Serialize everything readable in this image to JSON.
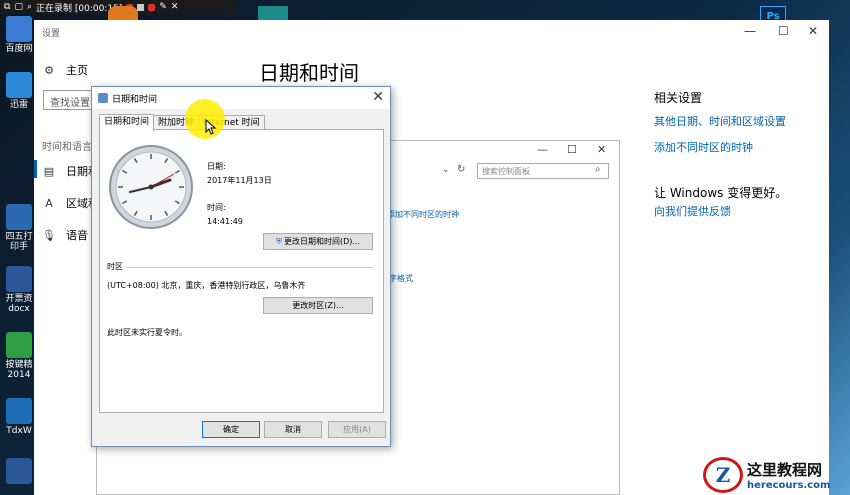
{
  "recorder": {
    "status": "正在录制 [00:00:15]"
  },
  "desktop": {
    "icons": [
      {
        "label": "百度网",
        "color": "#3a7bd5"
      },
      {
        "label": "迅雷",
        "color": "#2d8ad8"
      },
      {
        "label": "四五打印手",
        "color": "#2a6ab0"
      },
      {
        "label": "开票资docx",
        "color": "#2b579a"
      },
      {
        "label": "按键精2014",
        "color": "#2e9e44"
      },
      {
        "label": "TdxW",
        "color": "#1f6fb8"
      },
      {
        "label": "W",
        "color": "#2b579a"
      }
    ]
  },
  "settings": {
    "window_title": "设置",
    "nav": {
      "home": "主页",
      "search_placeholder": "查找设置",
      "section": "时间和语言",
      "items": [
        "日期和",
        "区域和",
        "语音"
      ]
    },
    "page_title": "日期和时间",
    "related": {
      "heading": "相关设置",
      "links": [
        "其他日期、时间和区域设置",
        "添加不同时区的时钟"
      ],
      "improve_heading": "让 Windows 变得更好。",
      "feedback_link": "向我们提供反馈"
    }
  },
  "control_panel": {
    "search_placeholder": "搜索控制面板",
    "partial_link_1": "添加不同时区的时钟",
    "partial_link_2": "字格式"
  },
  "dialog": {
    "title": "日期和时间",
    "tabs": [
      "日期和时间",
      "附加时钟",
      "Internet 时间"
    ],
    "date_label": "日期:",
    "date_value": "2017年11月13日",
    "time_label": "时间:",
    "time_value": "14:41:49",
    "change_datetime_button": "更改日期和时间(D)...",
    "timezone_heading": "时区",
    "timezone_value": "(UTC+08:00) 北京，重庆，香港特别行政区，乌鲁木齐",
    "change_timezone_button": "更改时区(Z)...",
    "dst_note": "此时区未实行夏令时。",
    "ok_button": "确定",
    "cancel_button": "取消",
    "apply_button": "应用(A)"
  },
  "watermark": {
    "cn": "这里教程网",
    "url": "herecours.com"
  }
}
